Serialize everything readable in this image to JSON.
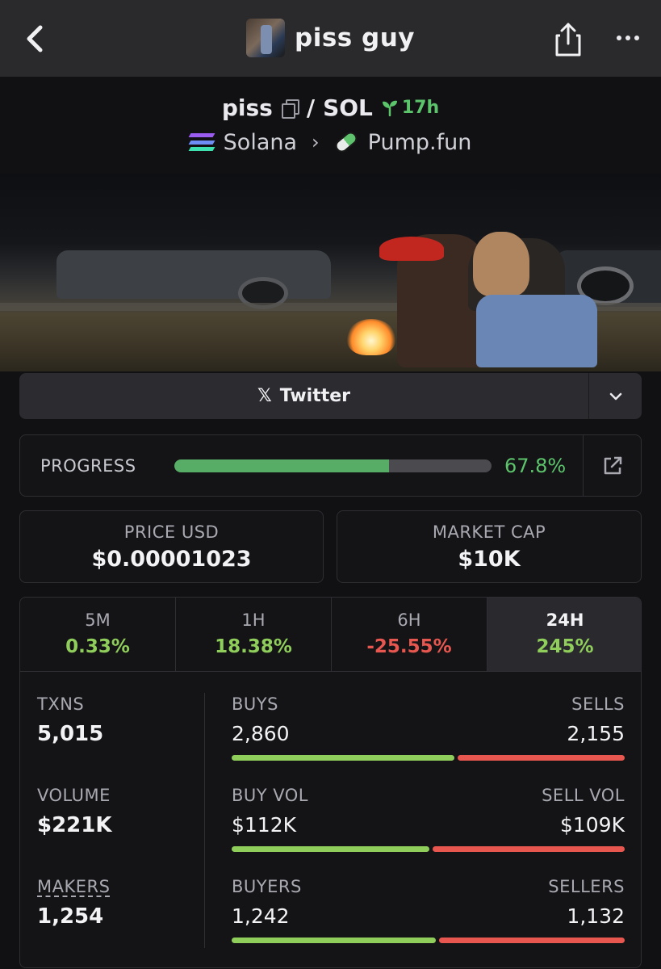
{
  "header": {
    "title": "piss guy",
    "back_icon": "chevron-left-icon",
    "share_icon": "share-icon",
    "more_icon": "more-horizontal-icon"
  },
  "pair": {
    "base": "piss",
    "separator": "/",
    "quote": "SOL",
    "age": "17h",
    "chain": "Solana",
    "dex": "Pump.fun"
  },
  "links": {
    "twitter_label": "Twitter"
  },
  "progress": {
    "label": "PROGRESS",
    "value_text": "67.8%",
    "fraction": 0.678
  },
  "price": {
    "label": "PRICE USD",
    "value": "$0.00001023"
  },
  "market_cap": {
    "label": "MARKET CAP",
    "value": "$10K"
  },
  "timeframes": [
    {
      "name": "5M",
      "change": "0.33%",
      "trend": "up"
    },
    {
      "name": "1H",
      "change": "18.38%",
      "trend": "up"
    },
    {
      "name": "6H",
      "change": "-25.55%",
      "trend": "down"
    },
    {
      "name": "24H",
      "change": "245%",
      "trend": "up",
      "selected": true
    }
  ],
  "stats": {
    "txns": {
      "label": "TXNS",
      "value": "5,015"
    },
    "volume": {
      "label": "VOLUME",
      "value": "$221K"
    },
    "makers": {
      "label": "MAKERS",
      "value": "1,254"
    },
    "buys_sells": {
      "left_label": "BUYS",
      "right_label": "SELLS",
      "left_value": "2,860",
      "right_value": "2,155",
      "left_share": 0.57
    },
    "buy_sell_vol": {
      "left_label": "BUY VOL",
      "right_label": "SELL VOL",
      "left_value": "$112K",
      "right_value": "$109K",
      "left_share": 0.507
    },
    "buyers_sellers": {
      "left_label": "BUYERS",
      "right_label": "SELLERS",
      "left_value": "1,242",
      "right_value": "1,132",
      "left_share": 0.523
    }
  },
  "colors": {
    "positive": "#8fce5b",
    "negative": "#e8574f",
    "progress": "#57ad65",
    "accent_green": "#5cc46b"
  }
}
